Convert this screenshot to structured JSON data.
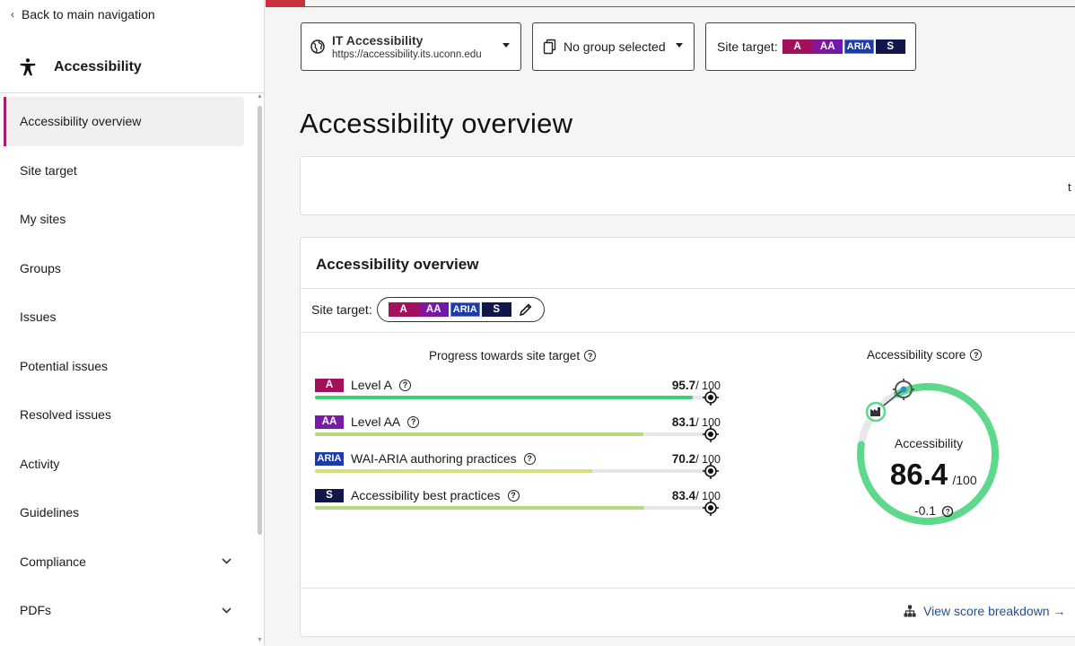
{
  "sidebar": {
    "back_label": "Back to main navigation",
    "section_title": "Accessibility",
    "items": [
      {
        "label": "Accessibility overview",
        "active": true
      },
      {
        "label": "Site target"
      },
      {
        "label": "My sites"
      },
      {
        "label": "Groups"
      },
      {
        "label": "Issues"
      },
      {
        "label": "Potential issues"
      },
      {
        "label": "Resolved issues"
      },
      {
        "label": "Activity"
      },
      {
        "label": "Guidelines"
      },
      {
        "label": "Compliance",
        "expandable": true
      },
      {
        "label": "PDFs",
        "expandable": true
      }
    ]
  },
  "selectors": {
    "site_name": "IT Accessibility",
    "site_url": "https://accessibility.its.uconn.edu",
    "group": "No group selected",
    "site_target_label": "Site target:"
  },
  "badges": {
    "a": "A",
    "aa": "AA",
    "aria": "ARIA",
    "s": "S"
  },
  "page_title": "Accessibility overview",
  "card1": {
    "text": "t"
  },
  "overview": {
    "heading": "Accessibility overview",
    "site_target_label": "Site target:",
    "progress_title": "Progress towards site target",
    "rows": [
      {
        "badge": "A",
        "label": "Level A",
        "value": "95.7",
        "max": "/ 100",
        "progress": 95.7,
        "color": "#3ecf78"
      },
      {
        "badge": "AA",
        "label": "Level AA",
        "value": "83.1",
        "max": "/ 100",
        "progress": 83.1,
        "color": "#b3da7c"
      },
      {
        "badge": "ARIA",
        "label": "WAI-ARIA authoring practices",
        "value": "70.2",
        "max": "/ 100",
        "progress": 70.2,
        "color": "#d6e07a"
      },
      {
        "badge": "S",
        "label": "Accessibility best practices",
        "value": "83.4",
        "max": "/ 100",
        "progress": 83.4,
        "color": "#b3da7c"
      }
    ],
    "score_title": "Accessibility score",
    "score": {
      "label": "Accessibility",
      "value": "86.4",
      "max": "/100",
      "change": "-0.1",
      "fraction": 0.864,
      "color": "#5ed88a"
    },
    "breakdown_link": "View score breakdown →"
  },
  "colors": {
    "accent": "#a1206e",
    "badge_a": "#a3115c",
    "badge_aa": "#7a1aa8",
    "badge_aria": "#1c3aa9",
    "badge_s": "#12164a",
    "link": "#1f4f9a"
  }
}
